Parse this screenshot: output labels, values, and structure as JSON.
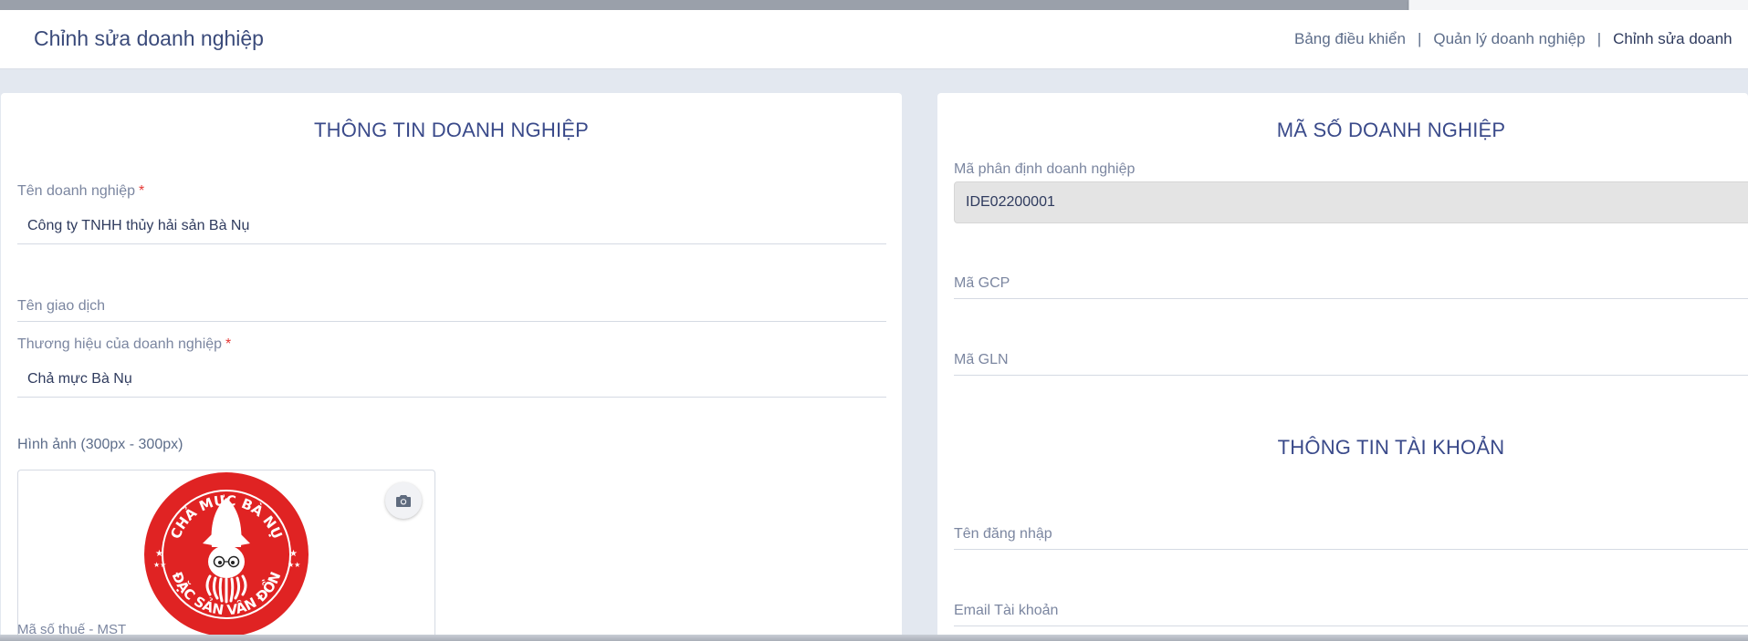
{
  "header": {
    "title": "Chỉnh sửa doanh nghiệp",
    "breadcrumb": [
      "Bảng điều khiển",
      "Quản lý doanh nghiệp",
      "Chỉnh sửa doanh"
    ],
    "separator": "|"
  },
  "left_card": {
    "section_title": "THÔNG TIN DOANH NGHIỆP",
    "business_name_label": "Tên doanh nghiệp",
    "business_name_value": "Công ty TNHH thủy hải sản Bà Nụ",
    "trade_name_label": "Tên giao dịch",
    "trade_name_value": "",
    "brand_label": "Thương hiệu của doanh nghiệp",
    "brand_value": "Chả mực Bà Nụ",
    "image_label": "Hình ảnh (300px - 300px)",
    "logo_top_text": "CHẢ MỰC BÀ NỤ",
    "logo_bottom_text": "ĐẶC SẢN VÂN ĐỒN",
    "tax_label": "Mã số thuế - MST",
    "required_mark": "*"
  },
  "right_card": {
    "section_title": "MÃ SỐ DOANH NGHIỆP",
    "id_label": "Mã phân định doanh nghiệp",
    "id_value": "IDE02200001",
    "gcp_label": "Mã GCP",
    "gln_label": "Mã GLN",
    "account_title": "THÔNG TIN TÀI KHOẢN",
    "username_label": "Tên đăng nhập",
    "email_label": "Email Tài khoản"
  },
  "colors": {
    "accent": "#3a4a8a",
    "required": "#e53935",
    "logo_red": "#e02323"
  },
  "icons": {
    "camera": "camera-icon"
  }
}
